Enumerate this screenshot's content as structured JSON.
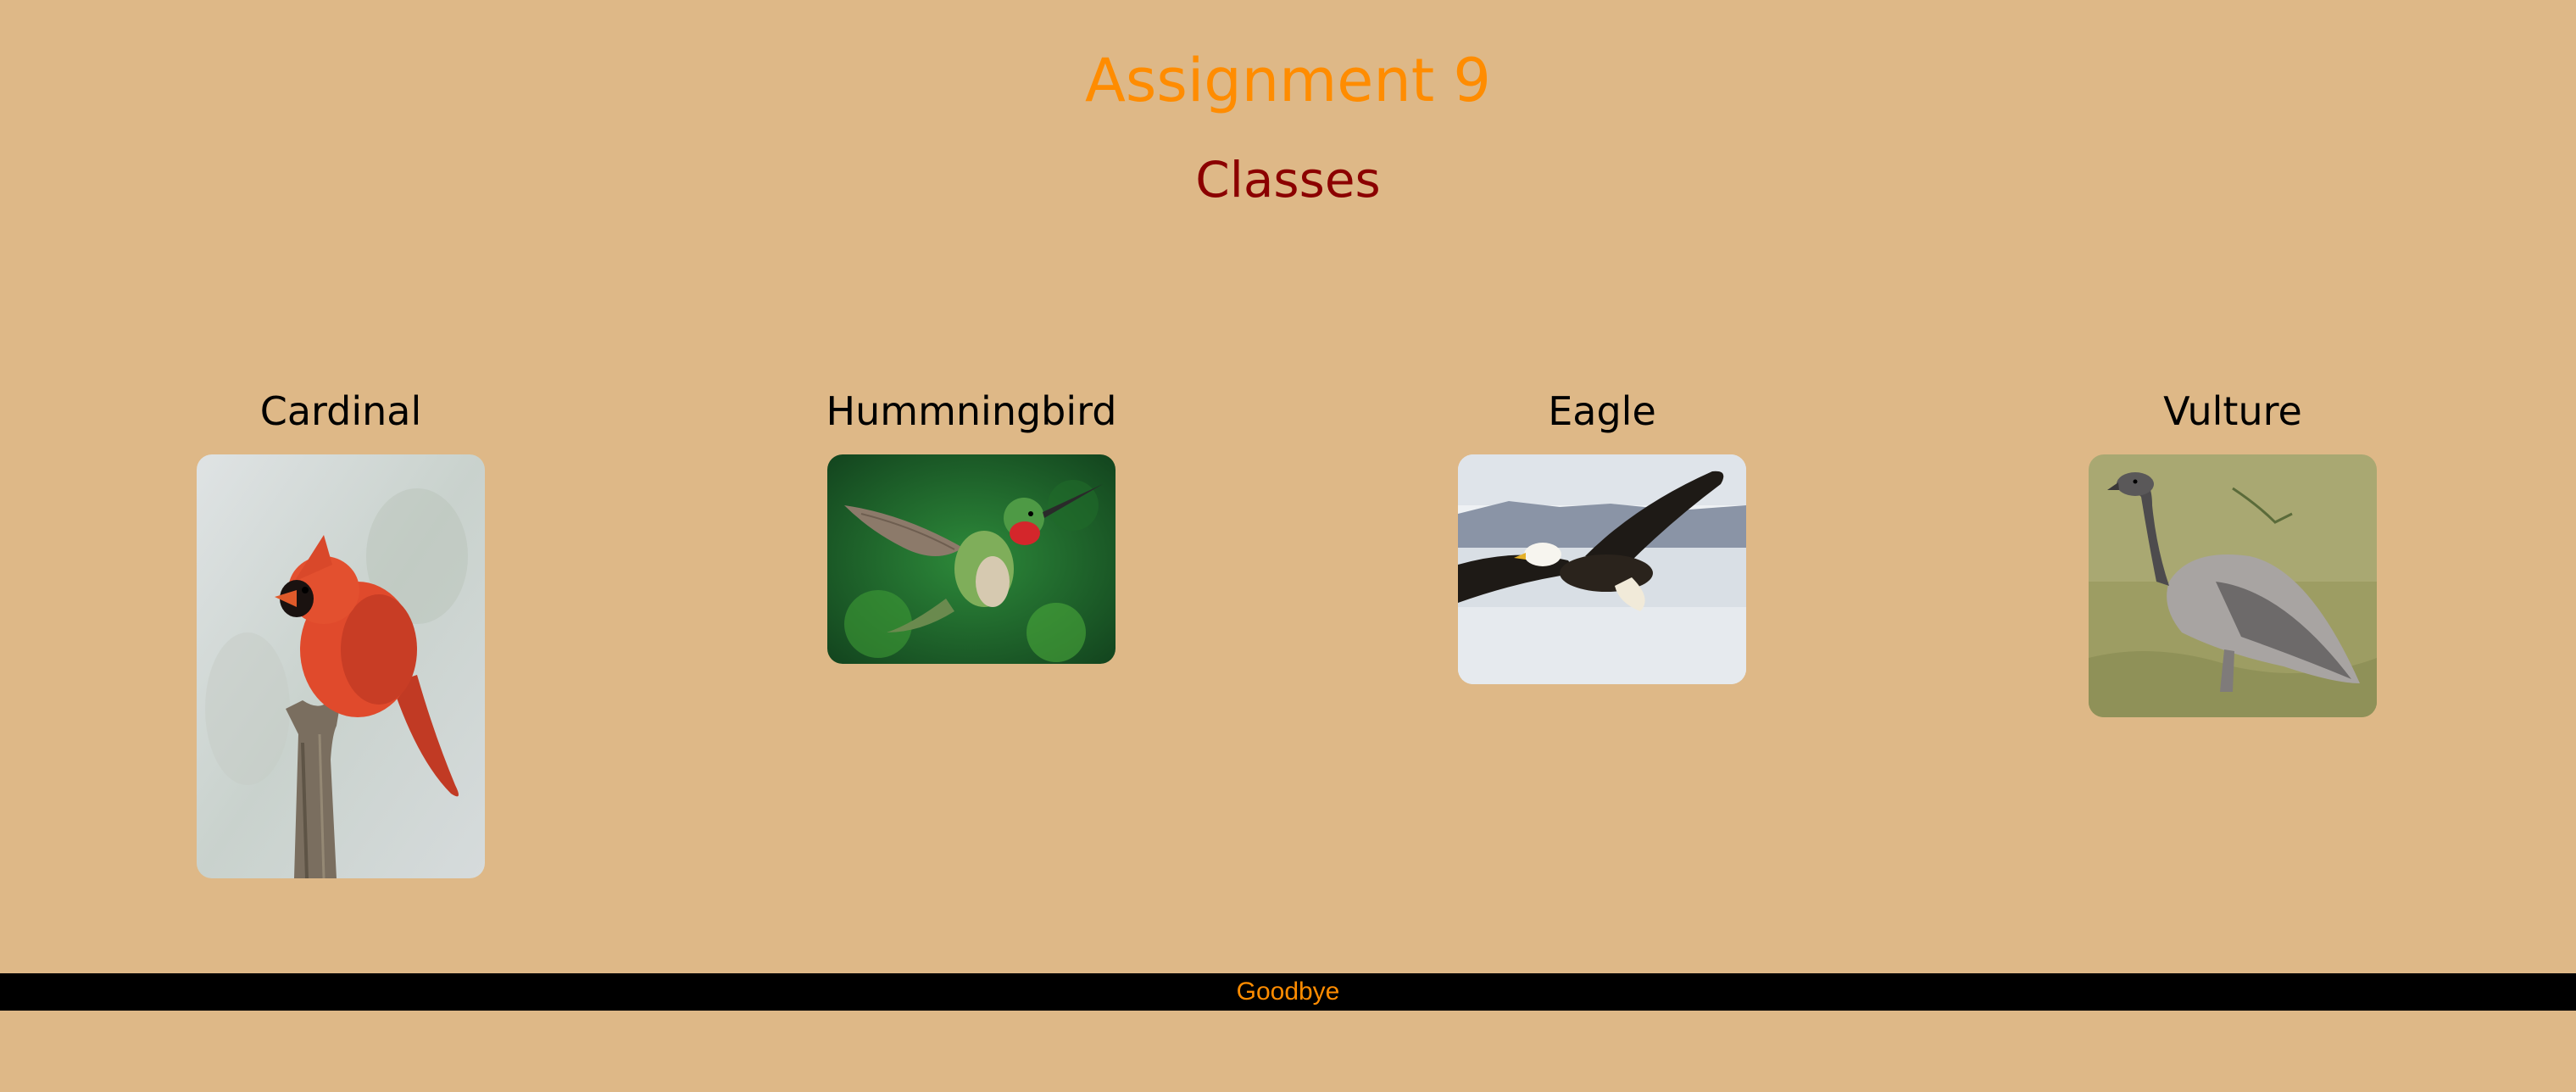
{
  "header": {
    "title": "Assignment 9",
    "subtitle": "Classes"
  },
  "birds": [
    {
      "name": "Cardinal",
      "image": "cardinal-image"
    },
    {
      "name": "Hummningbird",
      "image": "hummingbird-image"
    },
    {
      "name": "Eagle",
      "image": "eagle-image"
    },
    {
      "name": "Vulture",
      "image": "vulture-image"
    }
  ],
  "footer": {
    "text": "Goodbye"
  },
  "colors": {
    "background": "#deb887",
    "title": "#ff8c00",
    "subtitle": "#8b0000",
    "footer_bg": "#000000",
    "footer_text": "#ff8c00"
  }
}
